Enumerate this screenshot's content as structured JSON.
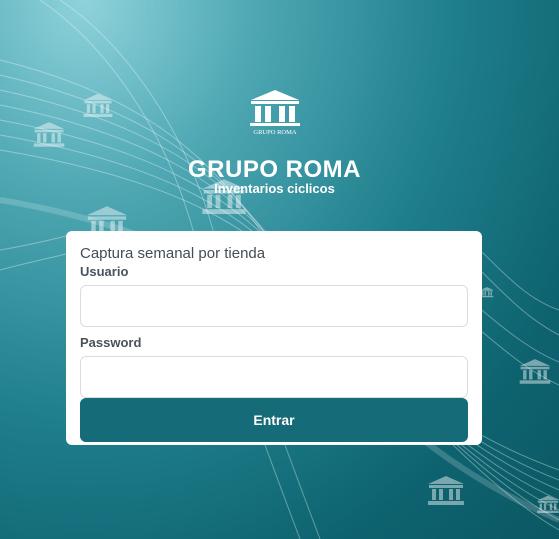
{
  "brand": {
    "logo_text": "GRUPO ROMA",
    "title": "GRUPO ROMA",
    "subtitle": "Inventarios ciclicos"
  },
  "login": {
    "heading": "Captura semanal por tienda",
    "username_label": "Usuario",
    "username_value": "",
    "password_label": "Password",
    "password_value": "",
    "submit_label": "Entrar"
  },
  "icons": {
    "logo": "temple-building-icon",
    "background": "temple-building-icon"
  },
  "colors": {
    "button": "#156b77",
    "background_dark": "#0e6370",
    "background_light": "#8fd3db"
  }
}
